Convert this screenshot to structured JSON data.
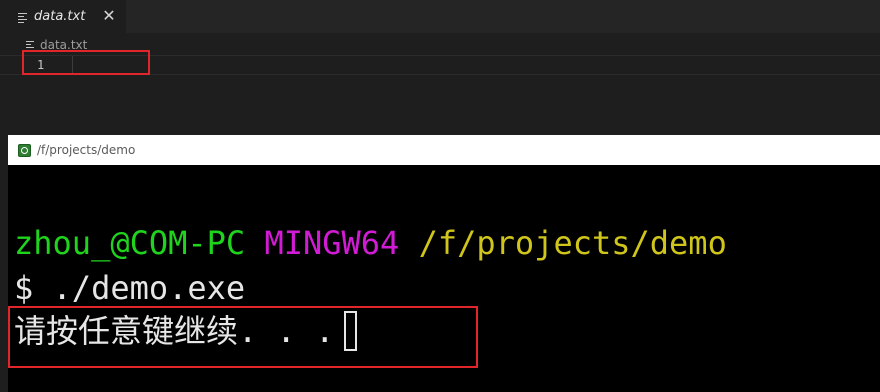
{
  "editor": {
    "tab": {
      "title": "data.txt",
      "close_glyph": "✕",
      "icon": "file-lines-icon"
    },
    "breadcrumb": {
      "file": "data.txt",
      "icon": "file-lines-icon"
    },
    "lines": [
      {
        "number": "1",
        "content": ""
      }
    ]
  },
  "terminal": {
    "title": "/f/projects/demo",
    "icon": "mintty-icon",
    "prompt": {
      "user": "zhou_@COM-PC",
      "env": "MINGW64",
      "path": "/f/projects/demo"
    },
    "command": "$ ./demo.exe",
    "output": "请按任意键继续. . ."
  },
  "colors": {
    "highlight": "#e0262a",
    "prompt_user": "#1fd41c",
    "prompt_env": "#d21bd4",
    "prompt_path": "#cfc51b",
    "terminal_bg": "#000000",
    "editor_bg": "#1e1e1e"
  }
}
